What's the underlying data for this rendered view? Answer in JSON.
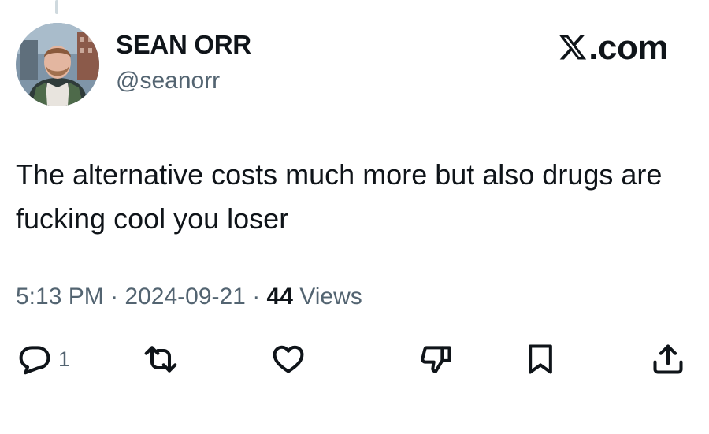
{
  "author": {
    "display_name": "SEAN ORR",
    "handle": "@seanorr"
  },
  "brand": {
    "label": ".com",
    "icon": "x-logo-icon"
  },
  "tweet": {
    "text": "The alternative costs much more but also drugs are fucking cool you loser"
  },
  "meta": {
    "time": "5:13 PM",
    "sep1": " · ",
    "date": "2024-09-21",
    "sep2": " · ",
    "views_count": "44",
    "views_label": " Views"
  },
  "actions": {
    "reply": {
      "icon": "reply-icon",
      "count": "1"
    },
    "retweet": {
      "icon": "retweet-icon"
    },
    "like": {
      "icon": "heart-icon"
    },
    "downvote": {
      "icon": "thumbs-down-icon"
    },
    "bookmark": {
      "icon": "bookmark-icon"
    },
    "share": {
      "icon": "share-icon"
    }
  },
  "colors": {
    "text_primary": "#0f1419",
    "text_secondary": "#536471",
    "thread_line": "#cfd9de"
  }
}
